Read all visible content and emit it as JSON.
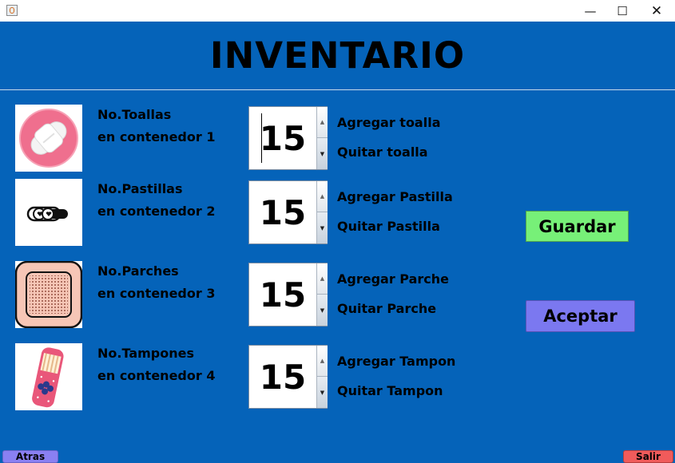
{
  "window": {
    "app_icon": "java-cup-icon",
    "minimize_glyph": "—",
    "maximize_glyph": "☐",
    "close_glyph": "✕"
  },
  "heading": "INVENTARIO",
  "rows": [
    {
      "icon": "sanitary-pad-icon",
      "label_line1": "No.Toallas",
      "label_line2": "en contenedor 1",
      "count": "15",
      "add_label": "Agregar toalla",
      "remove_label": "Quitar toalla"
    },
    {
      "icon": "pills-icon",
      "label_line1": "No.Pastillas",
      "label_line2": "en contenedor 2",
      "count": "15",
      "add_label": "Agregar Pastilla",
      "remove_label": "Quitar Pastilla"
    },
    {
      "icon": "patch-icon",
      "label_line1": "No.Parches",
      "label_line2": "en contenedor 3",
      "count": "15",
      "add_label": "Agregar Parche",
      "remove_label": "Quitar Parche"
    },
    {
      "icon": "tampon-icon",
      "label_line1": "No.Tampones",
      "label_line2": "en contenedor 4",
      "count": "15",
      "add_label": "Agregar Tampon",
      "remove_label": "Quitar Tampon"
    }
  ],
  "buttons": {
    "save": "Guardar",
    "accept": "Aceptar",
    "back": "Atras",
    "exit": "Salir"
  },
  "spinner_glyphs": {
    "up": "▲",
    "down": "▼"
  },
  "colors": {
    "background": "#0563b9",
    "save_button": "#77f078",
    "accept_button": "#7b78f0",
    "back_button": "#8a80f2",
    "exit_button": "#f05b5b"
  }
}
